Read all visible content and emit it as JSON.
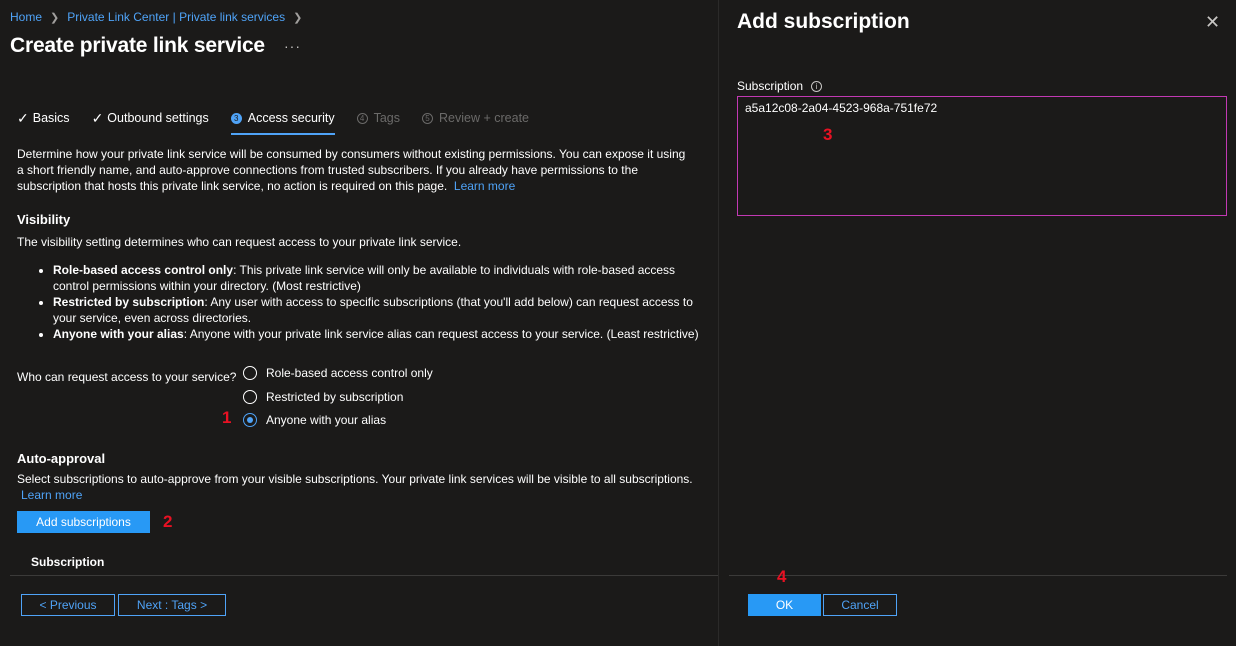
{
  "breadcrumb": {
    "home": "Home",
    "center": "Private Link Center | Private link services"
  },
  "page": {
    "title": "Create private link service",
    "more": "···"
  },
  "tabs": [
    {
      "label": "Basics",
      "state": "done"
    },
    {
      "label": "Outbound settings",
      "state": "done"
    },
    {
      "label": "Access security",
      "state": "active",
      "number": "3"
    },
    {
      "label": "Tags",
      "state": "disabled",
      "number": "4"
    },
    {
      "label": "Review + create",
      "state": "disabled",
      "number": "5"
    }
  ],
  "intro": {
    "text": "Determine how your private link service will be consumed by consumers without existing permissions. You can expose it using a short friendly name, and auto-approve connections from trusted subscribers. If you already have permissions to the subscription that hosts this private link service, no action is required on this page.",
    "learn_more": "Learn more"
  },
  "visibility": {
    "heading": "Visibility",
    "description": "The visibility setting determines who can request access to your private link service.",
    "bullets": [
      {
        "bold": "Role-based access control only",
        "text": ": This private link service will only be available to individuals with role-based access control permissions within your directory. (Most restrictive)"
      },
      {
        "bold": "Restricted by subscription",
        "text": ": Any user with access to specific subscriptions (that you'll add below) can request access to your service, even across directories."
      },
      {
        "bold": "Anyone with your alias",
        "text": ": Anyone with your private link service alias can request access to your service. (Least restrictive)"
      }
    ],
    "question": "Who can request access to your service?",
    "options": [
      {
        "label": "Role-based access control only",
        "checked": false
      },
      {
        "label": "Restricted by subscription",
        "checked": false
      },
      {
        "label": "Anyone with your alias",
        "checked": true
      }
    ]
  },
  "auto_approval": {
    "heading": "Auto-approval",
    "description": "Select subscriptions to auto-approve from your visible subscriptions. Your private link services will be visible to all subscriptions.",
    "learn_more": "Learn more",
    "add_button": "Add subscriptions",
    "column_header": "Subscription"
  },
  "footer": {
    "previous": "< Previous",
    "next": "Next : Tags >"
  },
  "panel": {
    "title": "Add subscription",
    "close": "✕",
    "field_label": "Subscription",
    "info": "i",
    "value": "a5a12c08-2a04-4523-968a-751fe72",
    "ok": "OK",
    "cancel": "Cancel"
  },
  "annotations": [
    "1",
    "2",
    "3",
    "4"
  ],
  "colors": {
    "background": "#1b1a19",
    "accent": "#4fa3f7",
    "primary_button": "#2899f5",
    "focus_border": "#c239b3",
    "annotation": "#e81123"
  }
}
